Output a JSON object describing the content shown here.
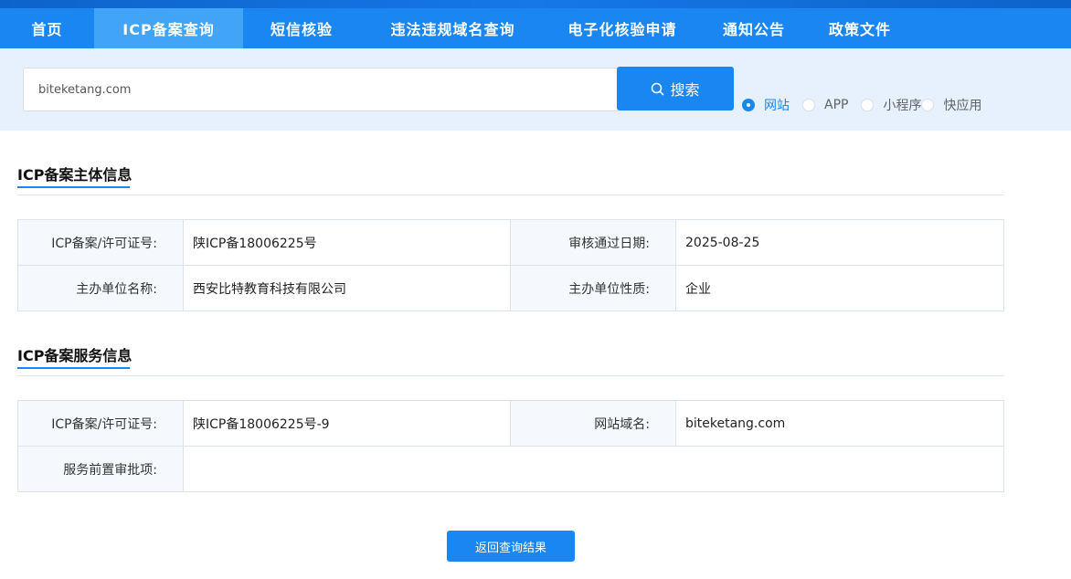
{
  "nav": {
    "items": [
      {
        "label": "首页"
      },
      {
        "label": "ICP备案查询"
      },
      {
        "label": "短信核验"
      },
      {
        "label": "违法违规域名查询"
      },
      {
        "label": "电子化核验申请"
      },
      {
        "label": "通知公告"
      },
      {
        "label": "政策文件"
      }
    ],
    "active": "ICP备案查询"
  },
  "search": {
    "value": "biteketang.com",
    "button_label": "搜索",
    "button_icon": "search-icon",
    "options": [
      {
        "label": "网站",
        "checked": true
      },
      {
        "label": "APP",
        "checked": false
      },
      {
        "label": "小程序",
        "checked": false
      },
      {
        "label": "快应用",
        "checked": false
      }
    ]
  },
  "subject": {
    "title": "ICP备案主体信息",
    "license_label": "ICP备案/许可证号:",
    "license_value": "陕ICP备18006225号",
    "date_label": "审核通过日期:",
    "date_value": "2025-08-25",
    "org_name_label": "主办单位名称:",
    "org_name_value": "西安比特教育科技有限公司",
    "org_type_label": "主办单位性质:",
    "org_type_value": "企业"
  },
  "service": {
    "title": "ICP备案服务信息",
    "license_label": "ICP备案/许可证号:",
    "license_value": "陕ICP备18006225号-9",
    "domain_label": "网站域名:",
    "domain_value": "biteketang.com",
    "approval_label": "服务前置审批项:",
    "approval_value": ""
  },
  "back_button_label": "返回查询结果",
  "colors": {
    "primary": "#1a86f1",
    "nav_active": "#41a4f7",
    "band": "#e6f1fd"
  }
}
